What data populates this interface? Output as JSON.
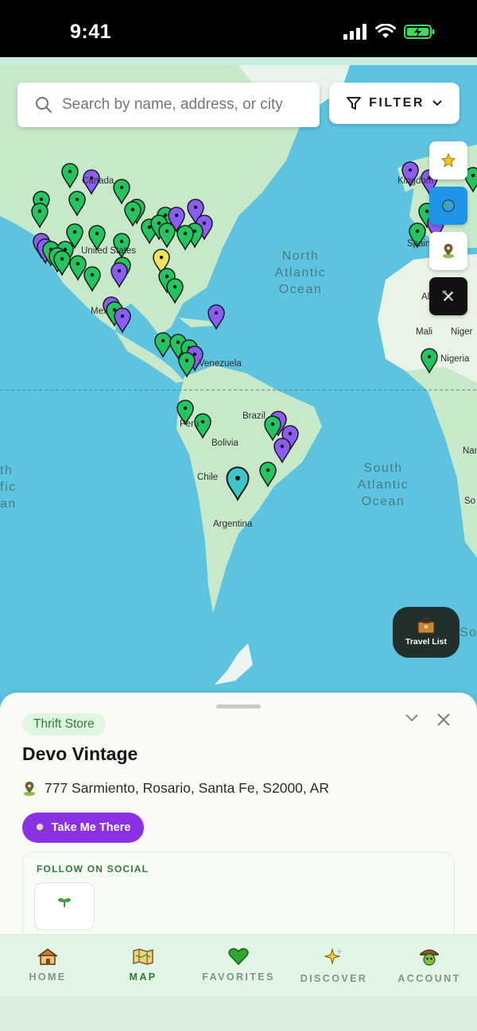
{
  "status": {
    "time": "9:41"
  },
  "search": {
    "placeholder": "Search by name, address, or city"
  },
  "filter": {
    "label": "FILTER"
  },
  "map": {
    "ocean_labels": [
      "North\nAtlantic\nOcean",
      "South\nAtlantic\nOcean"
    ],
    "north_atlantic": [
      "North",
      "Atlantic",
      "Ocean"
    ],
    "south_atlantic": [
      "South",
      "Atlantic",
      "Ocean"
    ],
    "partial_pacific": [
      "th",
      "fic",
      "an"
    ],
    "countries": {
      "canada": "Canada",
      "united_states": "United States",
      "mexico": "Mex",
      "venezuela": "Venezuela",
      "peru": "Peru",
      "brazil": "Brazil",
      "bolivia": "Bolivia",
      "chile": "Chile",
      "argentina": "Argentina",
      "spain": "Spain",
      "algeria": "Alg",
      "mali": "Mali",
      "niger": "Niger",
      "nigeria": "Nigeria",
      "kingdom": "Kingdom",
      "sou": "Sou",
      "south_cut": "So",
      "namib_cut": "Nam"
    },
    "pin_colors": {
      "green": "#22c55e",
      "purple": "#8b5cf6",
      "yellow": "#f2e35a",
      "teal": "#3ec6c9"
    }
  },
  "side_buttons": {
    "icons": [
      "star-icon",
      "globe-icon",
      "map-pin-icon",
      "tools-icon"
    ]
  },
  "travel_list": {
    "label": "Travel List"
  },
  "sheet": {
    "category": "Thrift Store",
    "title": "Devo Vintage",
    "address": "777 Sarmiento, Rosario, Santa Fe, S2000, AR",
    "take_me_there": "Take Me There",
    "social_title": "FOLLOW ON SOCIAL"
  },
  "tabs": [
    {
      "label": "HOME",
      "icon": "house-icon"
    },
    {
      "label": "MAP",
      "icon": "map-icon"
    },
    {
      "label": "FAVORITES",
      "icon": "heart-icon"
    },
    {
      "label": "DISCOVER",
      "icon": "sparkle-icon"
    },
    {
      "label": "ACCOUNT",
      "icon": "avatar-icon"
    }
  ],
  "colors": {
    "accent_purple": "#8a31e6",
    "accent_green": "#2e7d3a",
    "ocean": "#5bc3e0",
    "land": "#c8e9c9"
  }
}
